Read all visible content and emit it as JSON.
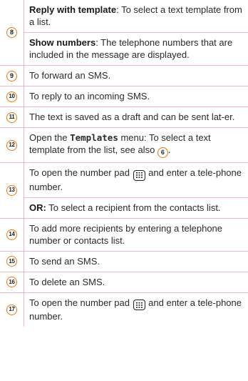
{
  "rows": [
    {
      "num": "8",
      "subs": [
        {
          "term": "Reply with template",
          "text": ": To select a text template from a list."
        },
        {
          "term": "Show numbers",
          "text": ": The telephone numbers that are included in the message are displayed."
        }
      ]
    },
    {
      "num": "9",
      "text": "To forward an SMS."
    },
    {
      "num": "10",
      "text": "To reply to an incoming SMS."
    },
    {
      "num": "11",
      "text": "The text is saved as a draft and can be sent lat-er."
    },
    {
      "num": "12",
      "pre": "Open the ",
      "menu": "Templates",
      "mid": " menu: To select a text template from the list, see also ",
      "ref": "6",
      "post": "."
    },
    {
      "num": "13",
      "pre": "To open the number pad ",
      "post": " and enter a tele-phone number.",
      "or_label": "OR:",
      "or_text": " To select a recipient from the contacts list."
    },
    {
      "num": "14",
      "text": "To add more recipients by entering a telephone number or contacts list."
    },
    {
      "num": "15",
      "text": "To send an SMS."
    },
    {
      "num": "16",
      "text": "To delete an SMS."
    },
    {
      "num": "17",
      "pre": "To open the number pad ",
      "post": " and enter a tele-phone number."
    }
  ],
  "icons": {
    "keypad": "keypad-icon"
  },
  "colors": {
    "badge_border": "#e8780a",
    "divider": "#f2b8c0"
  }
}
